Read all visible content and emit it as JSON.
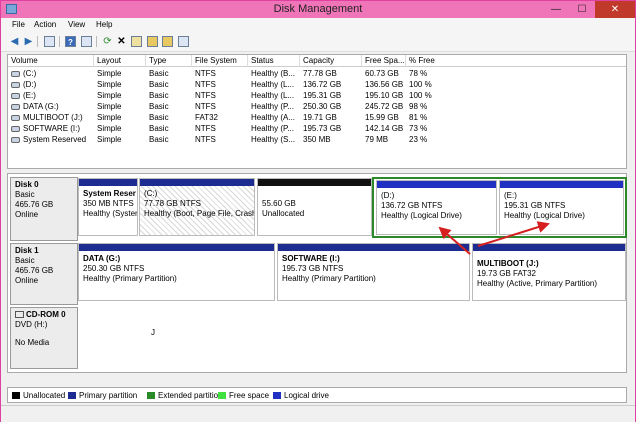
{
  "window": {
    "title": "Disk Management",
    "minimize": "—",
    "maximize": "☐",
    "close": "✕"
  },
  "menu": [
    "File",
    "Action",
    "View",
    "Help"
  ],
  "toolbar_icons": [
    "back-icon",
    "forward-icon",
    "console-tree-icon",
    "help-icon",
    "list-icon",
    "refresh-icon",
    "delete-icon",
    "properties-icon",
    "open-icon",
    "explore-icon"
  ],
  "table": {
    "headers": [
      "Volume",
      "Layout",
      "Type",
      "File System",
      "Status",
      "Capacity",
      "Free Spa...",
      "% Free"
    ],
    "rows": [
      [
        "(C:)",
        "Simple",
        "Basic",
        "NTFS",
        "Healthy (B...",
        "77.78 GB",
        "60.73 GB",
        "78 %"
      ],
      [
        "(D:)",
        "Simple",
        "Basic",
        "NTFS",
        "Healthy (L...",
        "136.72 GB",
        "136.56 GB",
        "100 %"
      ],
      [
        "(E:)",
        "Simple",
        "Basic",
        "NTFS",
        "Healthy (L...",
        "195.31 GB",
        "195.10 GB",
        "100 %"
      ],
      [
        "DATA (G:)",
        "Simple",
        "Basic",
        "NTFS",
        "Healthy (P...",
        "250.30 GB",
        "245.72 GB",
        "98 %"
      ],
      [
        "MULTIBOOT (J:)",
        "Simple",
        "Basic",
        "FAT32",
        "Healthy (A...",
        "19.71 GB",
        "15.99 GB",
        "81 %"
      ],
      [
        "SOFTWARE (I:)",
        "Simple",
        "Basic",
        "NTFS",
        "Healthy (P...",
        "195.73 GB",
        "142.14 GB",
        "73 %"
      ],
      [
        "System Reserved",
        "Simple",
        "Basic",
        "NTFS",
        "Healthy (S...",
        "350 MB",
        "79 MB",
        "23 %"
      ]
    ]
  },
  "disks": {
    "disk0": {
      "name": "Disk 0",
      "type": "Basic",
      "size": "465.76 GB",
      "status": "Online"
    },
    "disk1": {
      "name": "Disk 1",
      "type": "Basic",
      "size": "465.76 GB",
      "status": "Online"
    },
    "cdrom": {
      "name": "CD-ROM 0",
      "type": "DVD (H:)",
      "media": "No Media"
    }
  },
  "partitions": {
    "sysres": {
      "name": "System Reser",
      "size": "350 MB NTFS",
      "status": "Healthy (Syster"
    },
    "c": {
      "name": "(C:)",
      "size": "77.78 GB NTFS",
      "status": "Healthy (Boot, Page File, Crash"
    },
    "unalloc": {
      "size": "55.60 GB",
      "status": "Unallocated"
    },
    "d": {
      "name": "(D:)",
      "size": "136.72 GB NTFS",
      "status": "Healthy (Logical Drive)"
    },
    "e": {
      "name": "(E:)",
      "size": "195.31 GB NTFS",
      "status": "Healthy (Logical Drive)"
    },
    "g": {
      "name": "DATA  (G:)",
      "size": "250.30 GB NTFS",
      "status": "Healthy (Primary Partition)"
    },
    "i": {
      "name": "SOFTWARE  (I:)",
      "size": "195.73 GB NTFS",
      "status": "Healthy (Primary Partition)"
    },
    "j": {
      "name": "MULTIBOOT  (J:)",
      "size": "19.73 GB FAT32",
      "status": "Healthy (Active, Primary Partition)"
    }
  },
  "panel_text": "J",
  "legend": [
    {
      "label": "Unallocated",
      "color": "#000000"
    },
    {
      "label": "Primary partition",
      "color": "#1c2c90"
    },
    {
      "label": "Extended partition",
      "color": "#2a8a2a"
    },
    {
      "label": "Free space",
      "color": "#40e040"
    },
    {
      "label": "Logical drive",
      "color": "#2030c0"
    }
  ],
  "annotation_color": "#d62020"
}
